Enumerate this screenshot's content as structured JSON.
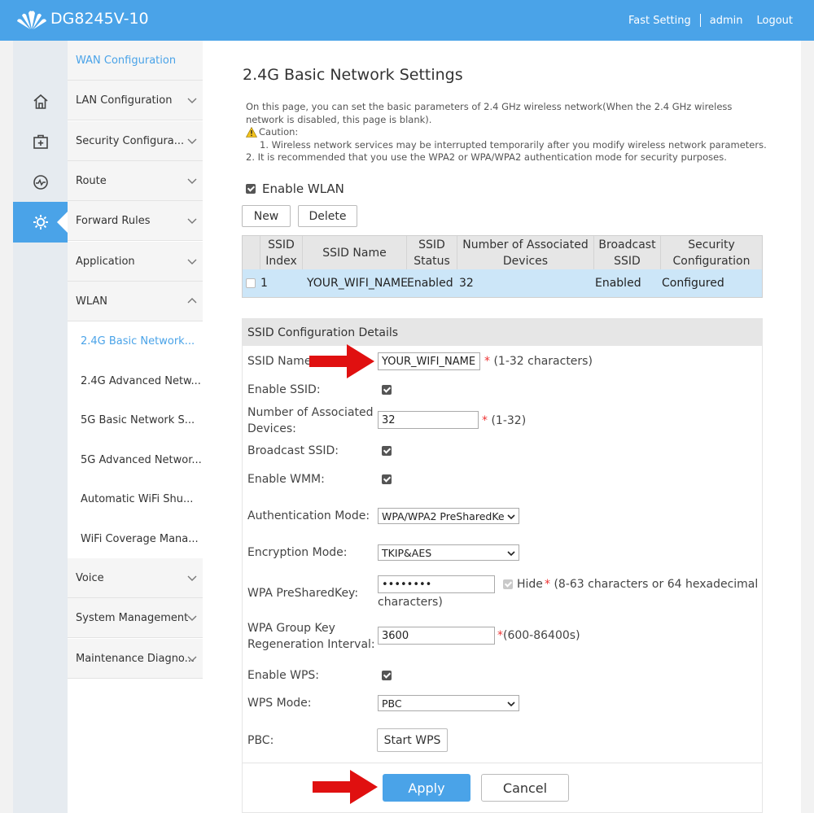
{
  "header": {
    "model": "DG8245V-10",
    "fast_setting": "Fast Setting",
    "user": "admin",
    "logout": "Logout",
    "accent_color": "#4aa3e8"
  },
  "icons": [
    "home-icon",
    "first-aid-icon",
    "gauge-icon",
    "gear-icon"
  ],
  "menu": {
    "items": [
      {
        "label": "WAN Configuration"
      },
      {
        "label": "LAN Configuration"
      },
      {
        "label": "Security Configura..."
      },
      {
        "label": "Route"
      },
      {
        "label": "Forward Rules"
      },
      {
        "label": "Application"
      },
      {
        "label": "WLAN"
      }
    ],
    "wlan_sub": [
      {
        "label": "2.4G Basic Network..."
      },
      {
        "label": "2.4G Advanced Netw..."
      },
      {
        "label": "5G Basic Network S..."
      },
      {
        "label": "5G Advanced Networ..."
      },
      {
        "label": "Automatic WiFi Shu..."
      },
      {
        "label": "WiFi Coverage Mana..."
      }
    ],
    "after": [
      {
        "label": "Voice"
      },
      {
        "label": "System Management"
      },
      {
        "label": "Maintenance Diagno..."
      }
    ]
  },
  "main": {
    "title": "2.4G Basic Network Settings",
    "desc": "On this page, you can set the basic parameters of 2.4 GHz wireless network(When the 2.4 GHz wireless network is disabled, this page is blank).",
    "caution": "Caution:",
    "note1": "1. Wireless network services may be interrupted temporarily after you modify wireless network parameters.",
    "note2": "2. It is recommended that you use the WPA2 or WPA/WPA2 authentication mode for security purposes.",
    "enable_wlan": "Enable WLAN",
    "new_btn": "New",
    "delete_btn": "Delete"
  },
  "table": {
    "headers": [
      "SSID Index",
      "SSID Name",
      "SSID Status",
      "Number of Associated Devices",
      "Broadcast SSID",
      "Security Configuration"
    ],
    "rows": [
      [
        "1",
        "YOUR_WIFI_NAME",
        "Enabled",
        "32",
        "Enabled",
        "Configured"
      ]
    ]
  },
  "details": {
    "title": "SSID Configuration Details",
    "ssid_name_label": "SSID Name:",
    "ssid_name_value": "YOUR_WIFI_NAME",
    "ssid_name_hint": "(1-32 characters)",
    "enable_ssid_label": "Enable SSID:",
    "assoc_label": "Number of Associated Devices:",
    "assoc_value": "32",
    "assoc_hint": "(1-32)",
    "broadcast_label": "Broadcast SSID:",
    "wmm_label": "Enable WMM:",
    "auth_label": "Authentication Mode:",
    "auth_value": "WPA/WPA2 PreSharedKe",
    "enc_label": "Encryption Mode:",
    "enc_value": "TKIP&AES",
    "psk_label": "WPA PreSharedKey:",
    "psk_value": "••••••••",
    "hide_label": "Hide",
    "psk_hint": "(8-63 characters or 64 hexadecimal",
    "psk_hint2": "characters)",
    "group_label": "WPA Group Key Regeneration Interval:",
    "group_value": "3600",
    "group_hint": "(600-86400s)",
    "wps_label": "Enable WPS:",
    "wps_mode_label": "WPS Mode:",
    "wps_mode_value": "PBC",
    "pbc_label": "PBC:",
    "start_wps": "Start WPS",
    "apply": "Apply",
    "cancel": "Cancel"
  }
}
